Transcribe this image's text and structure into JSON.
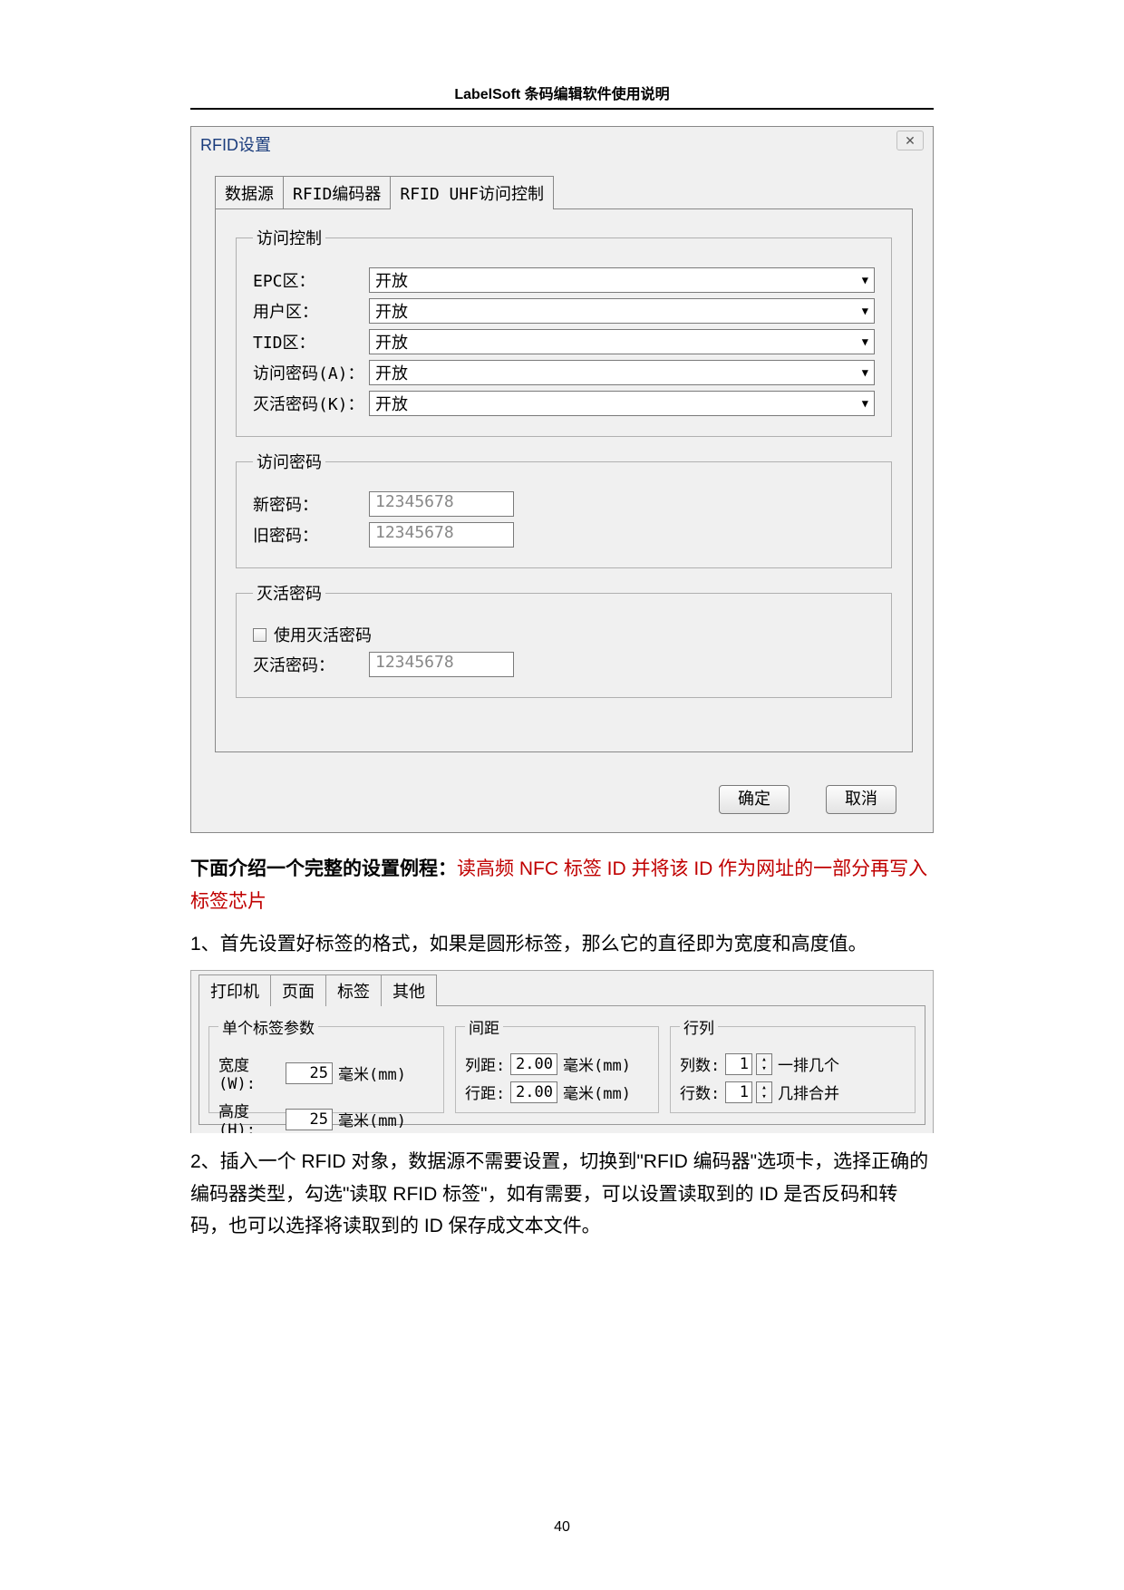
{
  "doc": {
    "header": "LabelSoft 条码编辑软件使用说明",
    "page_number": "40"
  },
  "dialog": {
    "title": "RFID设置",
    "tabs": [
      "数据源",
      "RFID编码器",
      "RFID UHF访问控制"
    ],
    "active_tab": 2,
    "access_control": {
      "legend": "访问控制",
      "rows": [
        {
          "label": "EPC区：",
          "value": "开放"
        },
        {
          "label": "用户区：",
          "value": "开放"
        },
        {
          "label": "TID区：",
          "value": "开放"
        },
        {
          "label": "访问密码(A)：",
          "value": "开放"
        },
        {
          "label": "灭活密码(K)：",
          "value": "开放"
        }
      ]
    },
    "access_pwd": {
      "legend": "访问密码",
      "rows": [
        {
          "label": "新密码：",
          "value": "12345678"
        },
        {
          "label": "旧密码：",
          "value": "12345678"
        }
      ]
    },
    "kill_pwd": {
      "legend": "灭活密码",
      "checkbox_label": "使用灭活密码",
      "row": {
        "label": "灭活密码：",
        "value": "12345678"
      }
    },
    "buttons": {
      "ok": "确定",
      "cancel": "取消"
    }
  },
  "text1": {
    "bold_prefix": "下面介绍一个完整的设置例程：",
    "red_part": "读高频 NFC 标签 ID 并将该 ID 作为网址的一部分再写入标签芯片"
  },
  "text2": "1、首先设置好标签的格式，如果是圆形标签，那么它的直径即为宽度和高度值。",
  "screenshot2": {
    "tabs": [
      "打印机",
      "页面",
      "标签",
      "其他"
    ],
    "active_tab": 2,
    "group1": {
      "legend": "单个标签参数",
      "width": {
        "label": "宽度(W):",
        "value": "25",
        "unit": "毫米(mm)"
      },
      "height": {
        "label": "高度(H):",
        "value": "25",
        "unit": "毫米(mm)"
      }
    },
    "group2": {
      "legend": "间距",
      "col": {
        "label": "列距:",
        "value": "2.00",
        "unit": "毫米(mm)"
      },
      "row": {
        "label": "行距:",
        "value": "2.00",
        "unit": "毫米(mm)"
      }
    },
    "group3": {
      "legend": "行列",
      "cols": {
        "label": "列数:",
        "value": "1",
        "suffix": "一排几个"
      },
      "rows": {
        "label": "行数:",
        "value": "1",
        "suffix": "几排合并"
      }
    }
  },
  "text3": "2、插入一个 RFID 对象，数据源不需要设置，切换到\"RFID 编码器\"选项卡，选择正确的编码器类型，勾选\"读取 RFID 标签\"，如有需要，可以设置读取到的 ID 是否反码和转码，也可以选择将读取到的 ID 保存成文本文件。"
}
